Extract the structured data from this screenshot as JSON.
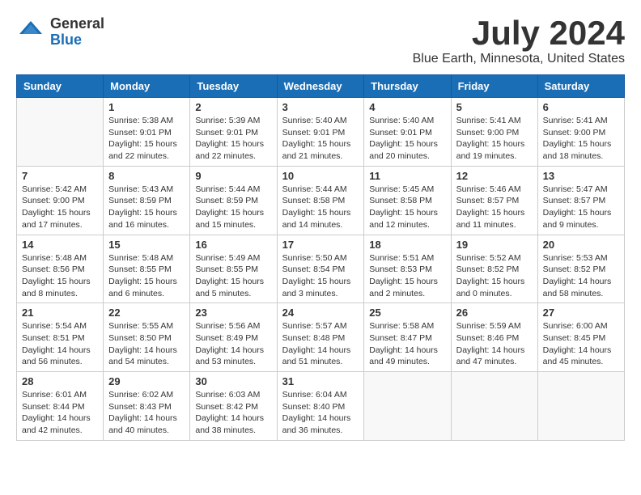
{
  "header": {
    "logo_general": "General",
    "logo_blue": "Blue",
    "month_title": "July 2024",
    "location": "Blue Earth, Minnesota, United States"
  },
  "days_of_week": [
    "Sunday",
    "Monday",
    "Tuesday",
    "Wednesday",
    "Thursday",
    "Friday",
    "Saturday"
  ],
  "weeks": [
    [
      {
        "day": "",
        "empty": true
      },
      {
        "day": "1",
        "sunrise": "Sunrise: 5:38 AM",
        "sunset": "Sunset: 9:01 PM",
        "daylight": "Daylight: 15 hours and 22 minutes."
      },
      {
        "day": "2",
        "sunrise": "Sunrise: 5:39 AM",
        "sunset": "Sunset: 9:01 PM",
        "daylight": "Daylight: 15 hours and 22 minutes."
      },
      {
        "day": "3",
        "sunrise": "Sunrise: 5:40 AM",
        "sunset": "Sunset: 9:01 PM",
        "daylight": "Daylight: 15 hours and 21 minutes."
      },
      {
        "day": "4",
        "sunrise": "Sunrise: 5:40 AM",
        "sunset": "Sunset: 9:01 PM",
        "daylight": "Daylight: 15 hours and 20 minutes."
      },
      {
        "day": "5",
        "sunrise": "Sunrise: 5:41 AM",
        "sunset": "Sunset: 9:00 PM",
        "daylight": "Daylight: 15 hours and 19 minutes."
      },
      {
        "day": "6",
        "sunrise": "Sunrise: 5:41 AM",
        "sunset": "Sunset: 9:00 PM",
        "daylight": "Daylight: 15 hours and 18 minutes."
      }
    ],
    [
      {
        "day": "7",
        "sunrise": "Sunrise: 5:42 AM",
        "sunset": "Sunset: 9:00 PM",
        "daylight": "Daylight: 15 hours and 17 minutes."
      },
      {
        "day": "8",
        "sunrise": "Sunrise: 5:43 AM",
        "sunset": "Sunset: 8:59 PM",
        "daylight": "Daylight: 15 hours and 16 minutes."
      },
      {
        "day": "9",
        "sunrise": "Sunrise: 5:44 AM",
        "sunset": "Sunset: 8:59 PM",
        "daylight": "Daylight: 15 hours and 15 minutes."
      },
      {
        "day": "10",
        "sunrise": "Sunrise: 5:44 AM",
        "sunset": "Sunset: 8:58 PM",
        "daylight": "Daylight: 15 hours and 14 minutes."
      },
      {
        "day": "11",
        "sunrise": "Sunrise: 5:45 AM",
        "sunset": "Sunset: 8:58 PM",
        "daylight": "Daylight: 15 hours and 12 minutes."
      },
      {
        "day": "12",
        "sunrise": "Sunrise: 5:46 AM",
        "sunset": "Sunset: 8:57 PM",
        "daylight": "Daylight: 15 hours and 11 minutes."
      },
      {
        "day": "13",
        "sunrise": "Sunrise: 5:47 AM",
        "sunset": "Sunset: 8:57 PM",
        "daylight": "Daylight: 15 hours and 9 minutes."
      }
    ],
    [
      {
        "day": "14",
        "sunrise": "Sunrise: 5:48 AM",
        "sunset": "Sunset: 8:56 PM",
        "daylight": "Daylight: 15 hours and 8 minutes."
      },
      {
        "day": "15",
        "sunrise": "Sunrise: 5:48 AM",
        "sunset": "Sunset: 8:55 PM",
        "daylight": "Daylight: 15 hours and 6 minutes."
      },
      {
        "day": "16",
        "sunrise": "Sunrise: 5:49 AM",
        "sunset": "Sunset: 8:55 PM",
        "daylight": "Daylight: 15 hours and 5 minutes."
      },
      {
        "day": "17",
        "sunrise": "Sunrise: 5:50 AM",
        "sunset": "Sunset: 8:54 PM",
        "daylight": "Daylight: 15 hours and 3 minutes."
      },
      {
        "day": "18",
        "sunrise": "Sunrise: 5:51 AM",
        "sunset": "Sunset: 8:53 PM",
        "daylight": "Daylight: 15 hours and 2 minutes."
      },
      {
        "day": "19",
        "sunrise": "Sunrise: 5:52 AM",
        "sunset": "Sunset: 8:52 PM",
        "daylight": "Daylight: 15 hours and 0 minutes."
      },
      {
        "day": "20",
        "sunrise": "Sunrise: 5:53 AM",
        "sunset": "Sunset: 8:52 PM",
        "daylight": "Daylight: 14 hours and 58 minutes."
      }
    ],
    [
      {
        "day": "21",
        "sunrise": "Sunrise: 5:54 AM",
        "sunset": "Sunset: 8:51 PM",
        "daylight": "Daylight: 14 hours and 56 minutes."
      },
      {
        "day": "22",
        "sunrise": "Sunrise: 5:55 AM",
        "sunset": "Sunset: 8:50 PM",
        "daylight": "Daylight: 14 hours and 54 minutes."
      },
      {
        "day": "23",
        "sunrise": "Sunrise: 5:56 AM",
        "sunset": "Sunset: 8:49 PM",
        "daylight": "Daylight: 14 hours and 53 minutes."
      },
      {
        "day": "24",
        "sunrise": "Sunrise: 5:57 AM",
        "sunset": "Sunset: 8:48 PM",
        "daylight": "Daylight: 14 hours and 51 minutes."
      },
      {
        "day": "25",
        "sunrise": "Sunrise: 5:58 AM",
        "sunset": "Sunset: 8:47 PM",
        "daylight": "Daylight: 14 hours and 49 minutes."
      },
      {
        "day": "26",
        "sunrise": "Sunrise: 5:59 AM",
        "sunset": "Sunset: 8:46 PM",
        "daylight": "Daylight: 14 hours and 47 minutes."
      },
      {
        "day": "27",
        "sunrise": "Sunrise: 6:00 AM",
        "sunset": "Sunset: 8:45 PM",
        "daylight": "Daylight: 14 hours and 45 minutes."
      }
    ],
    [
      {
        "day": "28",
        "sunrise": "Sunrise: 6:01 AM",
        "sunset": "Sunset: 8:44 PM",
        "daylight": "Daylight: 14 hours and 42 minutes."
      },
      {
        "day": "29",
        "sunrise": "Sunrise: 6:02 AM",
        "sunset": "Sunset: 8:43 PM",
        "daylight": "Daylight: 14 hours and 40 minutes."
      },
      {
        "day": "30",
        "sunrise": "Sunrise: 6:03 AM",
        "sunset": "Sunset: 8:42 PM",
        "daylight": "Daylight: 14 hours and 38 minutes."
      },
      {
        "day": "31",
        "sunrise": "Sunrise: 6:04 AM",
        "sunset": "Sunset: 8:40 PM",
        "daylight": "Daylight: 14 hours and 36 minutes."
      },
      {
        "day": "",
        "empty": true
      },
      {
        "day": "",
        "empty": true
      },
      {
        "day": "",
        "empty": true
      }
    ]
  ]
}
